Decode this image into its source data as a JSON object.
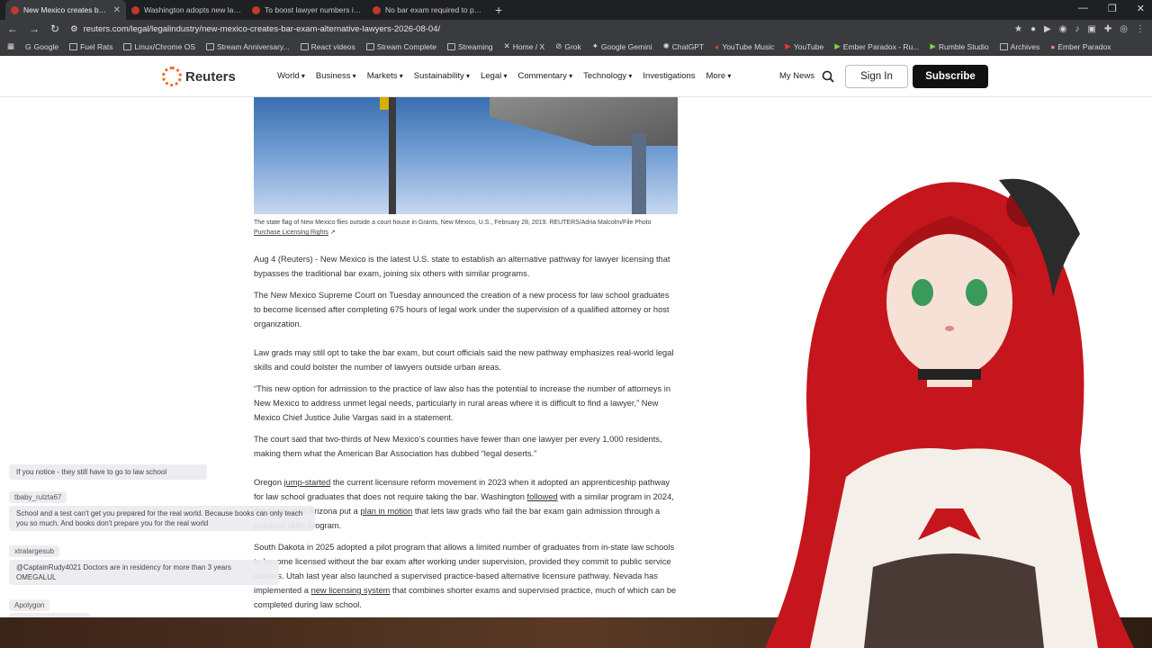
{
  "browser": {
    "tabs": [
      {
        "title": "New Mexico creates bar e",
        "active": true
      },
      {
        "title": "Washington adopts new lawye",
        "active": false
      },
      {
        "title": "To boost lawyer numbers in 'le",
        "active": false
      },
      {
        "title": "No bar exam required to pract",
        "active": false
      }
    ],
    "new_tab": "+",
    "url": "reuters.com/legal/legalindustry/new-mexico-creates-bar-exam-alternative-lawyers-2026-08-04/",
    "bookmarks": [
      "Google",
      "Fuel Rats",
      "Linux/Chrome OS",
      "Stream Anniversary...",
      "React videos",
      "Stream Complete",
      "Streaming",
      "Home / X",
      "Grok",
      "Google Gemini",
      "ChatGPT",
      "YouTube Music",
      "YouTube",
      "Ember Paradox - Ru...",
      "Rumble Studio",
      "Archives",
      "Ember Paradox"
    ]
  },
  "site": {
    "logo": "Reuters",
    "menu": [
      "World",
      "Business",
      "Markets",
      "Sustainability",
      "Legal",
      "Commentary",
      "Technology",
      "Investigations",
      "More"
    ],
    "my_news": "My News",
    "sign_in": "Sign In",
    "subscribe": "Subscribe"
  },
  "article": {
    "caption": "The state flag of New Mexico flies outside a court house in Grants, New Mexico, U.S., February 28, 2019. REUTERS/Adria Malcolm/File Photo",
    "licensing": "Purchase Licensing Rights",
    "p1": "Aug 4 (Reuters) - New Mexico is the latest U.S. state to establish an alternative pathway for lawyer licensing that bypasses the traditional bar exam, joining six others with similar programs.",
    "p2": "The New Mexico Supreme Court on Tuesday announced the creation of a new process for law school graduates to become licensed after completing 675 hours of legal work under the supervision of a qualified attorney or host organization.",
    "p3": "Law grads may still opt to take the bar exam, but court officials said the new pathway emphasizes real-world legal skills and could bolster the number of lawyers outside urban areas.",
    "p4": "“This new option for admission to the practice of law also has the potential to increase the number of attorneys in New Mexico to address unmet legal needs, particularly in rural areas where it is difficult to find a lawyer,” New Mexico Chief Justice Julie Vargas said in a statement.",
    "p5": "The court said that two-thirds of New Mexico’s counties have fewer than one lawyer per every 1,000 residents, making them what the American Bar Association has dubbed “legal deserts.”",
    "p6a": "Oregon ",
    "p6_link1": "jump-started",
    "p6b": " the current licensure reform movement in 2023 when it adopted an apprenticeship pathway for law school graduates that does not require taking the bar. Washington ",
    "p6_link2": "followed",
    "p6c": " with a similar program in 2024, the same year Arizona put a ",
    "p6_link3": "plan in motion",
    "p6d": " that lets law grads who fail the bar exam gain admission through a practical skills program.",
    "p7a": "South Dakota in 2025 adopted a pilot program that allows a limited number of graduates from in-state law schools to become licensed without the bar exam after working under supervision, provided they commit to public service careers. Utah last year also launched a supervised practice-based alternative licensure pathway. Nevada has implemented a ",
    "p7_link": "new licensing system",
    "p7b": " that combines shorter exams and supervised practice, much of which can be completed during law school."
  },
  "chat": [
    {
      "name": "",
      "message": "If you notice - they still have to go to law school"
    },
    {
      "name": "tbaby_rulzta67",
      "message": "School and a test can't get you prepared for the real world. Because books can only teach you so much. And books don't prepare you for the real world"
    },
    {
      "name": "xtralargesub",
      "message": "@CaptainRudy4021 Doctors are in residency for more than 3 years OMEGALUL"
    },
    {
      "name": "Apolygon",
      "message": ""
    }
  ],
  "colors": {
    "accent": "#f26b21",
    "subscribe_bg": "#111111",
    "hair": "#c4161c"
  }
}
